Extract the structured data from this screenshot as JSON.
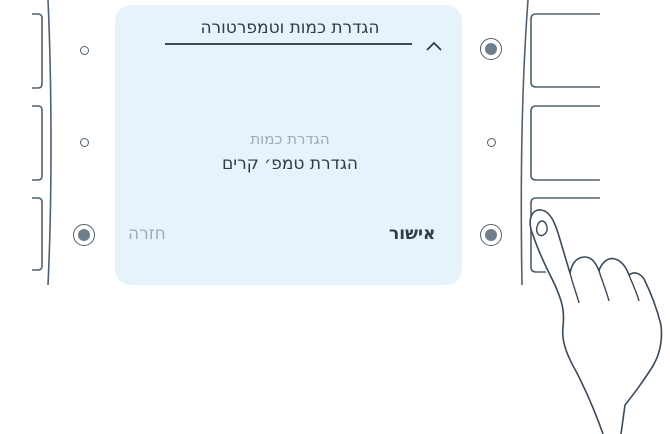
{
  "screen": {
    "title": "הגדרת כמות וטמפרטורה",
    "menu_options": [
      {
        "label": "הגדרת כמות",
        "selected": false
      },
      {
        "label": "הגדרת טמפ׳ קרים",
        "selected": true
      }
    ],
    "soft_keys": {
      "back_label": "חזרה",
      "confirm_label": "אישור"
    }
  },
  "colors": {
    "screen_background": "#e6f3fb",
    "text_primary": "#2d3b48",
    "text_muted": "#a0aab4",
    "outline": "#50606e"
  },
  "icons": {
    "scroll_up": "chevron-up-icon",
    "pointer": "hand-pointer-icon"
  }
}
